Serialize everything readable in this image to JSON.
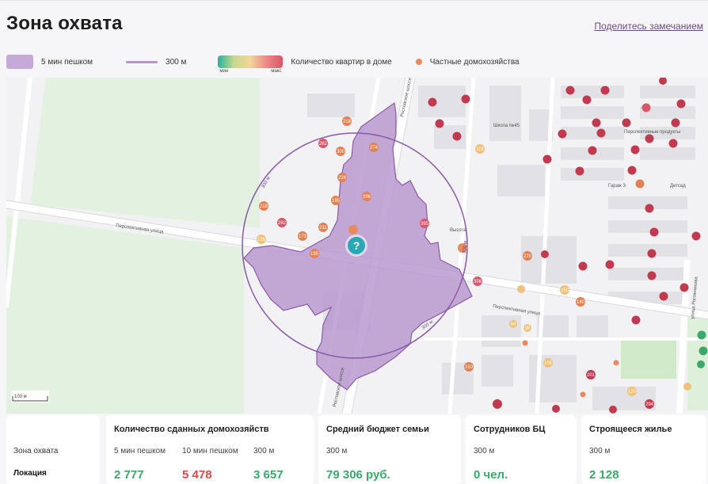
{
  "header": {
    "title": "Зона охвата",
    "share_link": "Поделитесь замечанием"
  },
  "legend": {
    "walk_label": "5 мин пешком",
    "radius_label": "300 м",
    "gradient_min": "мин",
    "gradient_max": "макс",
    "apartments_label": "Количество квартир в доме",
    "private_label": "Частные домохозяйства"
  },
  "map": {
    "scale_label": "100 м",
    "street_labels": [
      "Перспективная улица",
      "Перспективная улица",
      "Ростовское шоссе",
      "Ростовское шоссе",
      "улица Рогожникова",
      "Школа №45",
      "Гараж 3",
      "Детсад",
      "Перспективные продукты",
      "Высота",
      "300 м",
      "300 м",
      "300 м"
    ],
    "markers": [
      "218",
      "274",
      "300",
      "226",
      "195",
      "296",
      "262",
      "218",
      "173",
      "211",
      "135",
      "195",
      "395",
      "119",
      "306",
      "220",
      "94",
      "98",
      "210",
      "106",
      "201",
      "294",
      "120",
      "150",
      "140"
    ],
    "colors": {
      "zone_fill": "#b795cd",
      "zone_stroke": "#8a5aa8",
      "circle_stroke": "#8a5aa8",
      "pin": "#2aa6b4",
      "marker_red": "#c23a4f",
      "marker_orange": "#e28153",
      "marker_yellow": "#eec27a",
      "marker_green": "#3aa96a"
    }
  },
  "stats": {
    "row1_label": "Зона охвата",
    "row2_label": "Локация",
    "households": {
      "title": "Количество сданных домохозяйств",
      "cols": [
        {
          "label": "5 мин пешком",
          "value": "2 777",
          "color": "green"
        },
        {
          "label": "10 мин пешком",
          "value": "5 478",
          "color": "red"
        },
        {
          "label": "300 м",
          "value": "3 657",
          "color": "green"
        }
      ]
    },
    "budget": {
      "title": "Средний бюджет семьи",
      "sub": "300 м",
      "value": "79 306 руб."
    },
    "employees": {
      "title": "Сотрудников БЦ",
      "sub": "300 м",
      "value": "0 чел."
    },
    "construction": {
      "title": "Строящееся жилье",
      "sub": "300 м",
      "value": "2 128"
    }
  }
}
